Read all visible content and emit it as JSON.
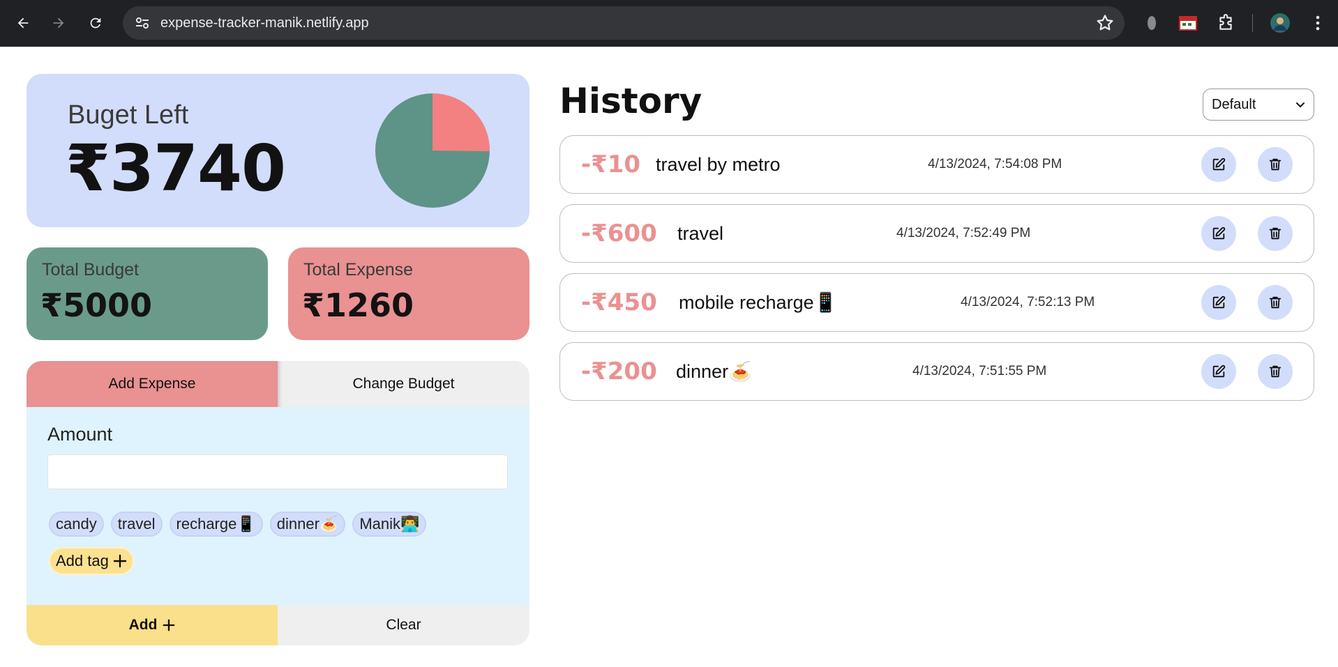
{
  "browser": {
    "url": "expense-tracker-manik.netlify.app"
  },
  "budget_left": {
    "label": "Buget Left",
    "amount": "₹3740",
    "pie": {
      "expense_value": 1260,
      "total_value": 5000,
      "remaining_color": "#5e9388",
      "expense_color": "#f38181"
    }
  },
  "total_budget": {
    "label": "Total Budget",
    "amount": "₹5000",
    "color": "#6a9b8a"
  },
  "total_expense": {
    "label": "Total Expense",
    "amount": "₹1260",
    "color": "#ea9191"
  },
  "form": {
    "tabs": [
      "Add Expense",
      "Change Budget"
    ],
    "amount_label": "Amount",
    "amount_value": "",
    "tags": [
      "candy",
      "travel",
      "recharge📱",
      "dinner🍝",
      "Manik👨‍💻"
    ],
    "add_tag_label": "Add tag",
    "add_button": "Add",
    "clear_button": "Clear"
  },
  "history": {
    "title": "History",
    "sort_selected": "Default",
    "items": [
      {
        "amount": "-₹10",
        "name": "travel by metro",
        "date": "4/13/2024, 7:54:08 PM"
      },
      {
        "amount": "-₹600",
        "name": "travel",
        "date": "4/13/2024, 7:52:49 PM"
      },
      {
        "amount": "-₹450",
        "name": "mobile recharge📱",
        "date": "4/13/2024, 7:52:13 PM"
      },
      {
        "amount": "-₹200",
        "name": "dinner🍝",
        "date": "4/13/2024, 7:51:55 PM"
      }
    ]
  },
  "icons": {
    "edit": "edit-icon",
    "delete": "trash-icon"
  },
  "colors": {
    "accent_blue": "#d2ddfc",
    "expense_red": "#ea9191",
    "budget_green": "#6a9b8a",
    "yellow": "#fbe08b",
    "form_bg": "#dff3fe"
  }
}
